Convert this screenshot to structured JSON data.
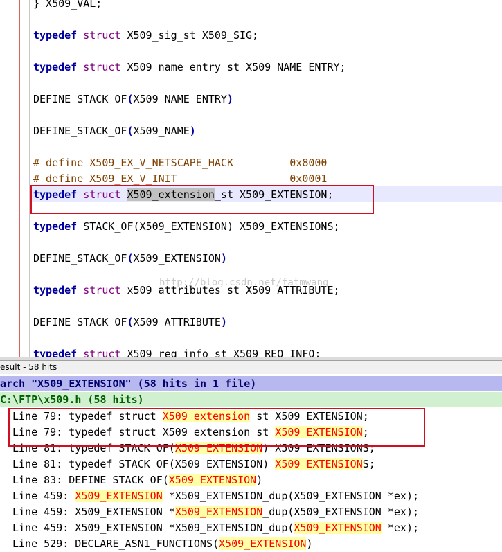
{
  "editor": {
    "lines": [
      {
        "segs": [
          {
            "t": "} X509_VAL;"
          }
        ]
      },
      {
        "segs": []
      },
      {
        "segs": [
          {
            "t": "typedef",
            "c": "kw"
          },
          {
            "t": " "
          },
          {
            "t": "struct",
            "c": "ty"
          },
          {
            "t": " X509_sig_st X509_SIG;"
          }
        ]
      },
      {
        "segs": []
      },
      {
        "segs": [
          {
            "t": "typedef",
            "c": "kw"
          },
          {
            "t": " "
          },
          {
            "t": "struct",
            "c": "ty"
          },
          {
            "t": " X509_name_entry_st X509_NAME_ENTRY;"
          }
        ]
      },
      {
        "segs": []
      },
      {
        "segs": [
          {
            "t": "DEFINE_STACK_OF"
          },
          {
            "t": "(",
            "c": "kw"
          },
          {
            "t": "X509_NAME_ENTRY"
          },
          {
            "t": ")",
            "c": "kw"
          }
        ]
      },
      {
        "segs": []
      },
      {
        "segs": [
          {
            "t": "DEFINE_STACK_OF"
          },
          {
            "t": "(",
            "c": "kw"
          },
          {
            "t": "X509_NAME"
          },
          {
            "t": ")",
            "c": "kw"
          }
        ]
      },
      {
        "segs": []
      },
      {
        "segs": [
          {
            "t": "# define X509_EX_V_NETSCAPE_HACK         0x8000",
            "c": "pp"
          }
        ]
      },
      {
        "segs": [
          {
            "t": "# define X509_EX_V_INIT                  0x0001",
            "c": "pp"
          }
        ]
      },
      {
        "segs": [
          {
            "t": "typedef",
            "c": "kw"
          },
          {
            "t": " "
          },
          {
            "t": "struct",
            "c": "ty"
          },
          {
            "t": " "
          },
          {
            "t": "X509_extension",
            "c": "sel"
          },
          {
            "t": "_st X509_EXTENSION;"
          }
        ]
      },
      {
        "segs": []
      },
      {
        "segs": [
          {
            "t": "typedef",
            "c": "kw"
          },
          {
            "t": " STACK_OF(X509_EXTENSION) X509_EXTENSIONS;"
          }
        ]
      },
      {
        "segs": []
      },
      {
        "segs": [
          {
            "t": "DEFINE_STACK_OF"
          },
          {
            "t": "(",
            "c": "kw"
          },
          {
            "t": "X509_EXTENSION"
          },
          {
            "t": ")",
            "c": "kw"
          }
        ]
      },
      {
        "segs": []
      },
      {
        "segs": [
          {
            "t": "typedef",
            "c": "kw"
          },
          {
            "t": " "
          },
          {
            "t": "struct",
            "c": "ty"
          },
          {
            "t": " x509_attributes_st X509_ATTRIBUTE;"
          }
        ]
      },
      {
        "segs": []
      },
      {
        "segs": [
          {
            "t": "DEFINE_STACK_OF"
          },
          {
            "t": "(",
            "c": "kw"
          },
          {
            "t": "X509_ATTRIBUTE"
          },
          {
            "t": ")",
            "c": "kw"
          }
        ]
      },
      {
        "segs": []
      },
      {
        "segs": [
          {
            "t": "typedef",
            "c": "kw"
          },
          {
            "t": " "
          },
          {
            "t": "struct",
            "c": "ty"
          },
          {
            "t": " X509_req_info_st X509_REQ_INFO;"
          }
        ]
      }
    ],
    "watermark": "http://blog.csdn.net/fatmwang"
  },
  "finder": {
    "title": "esult - 58 hits",
    "search_header": "arch \"X509_EXTENSION\" (58 hits in 1 file)",
    "file_header": "C:\\FTP\\x509.h (58 hits)",
    "results": [
      {
        "segs": [
          {
            "t": "Line 79: typedef struct "
          },
          {
            "t": "X509_extension",
            "m": 1
          },
          {
            "t": "_st X509_EXTENSION;"
          }
        ]
      },
      {
        "segs": [
          {
            "t": "Line 79: typedef struct X509_extension_st "
          },
          {
            "t": "X509_EXTENSION",
            "m": 1
          },
          {
            "t": ";"
          }
        ]
      },
      {
        "segs": [
          {
            "t": "Line 81: typedef STACK_OF("
          },
          {
            "t": "X509_EXTENSION",
            "m": 1
          },
          {
            "t": ") X509_EXTENSIONS;"
          }
        ]
      },
      {
        "segs": [
          {
            "t": "Line 81: typedef STACK_OF(X509_EXTENSION) "
          },
          {
            "t": "X509_EXTENSION",
            "m": 1
          },
          {
            "t": "S;"
          }
        ]
      },
      {
        "segs": [
          {
            "t": "Line 83: DEFINE_STACK_OF("
          },
          {
            "t": "X509_EXTENSION",
            "m": 1
          },
          {
            "t": ")"
          }
        ]
      },
      {
        "segs": [
          {
            "t": "Line 459: "
          },
          {
            "t": "X509_EXTENSION",
            "m": 1
          },
          {
            "t": " *X509_EXTENSION_dup(X509_EXTENSION *ex);"
          }
        ]
      },
      {
        "segs": [
          {
            "t": "Line 459: X509_EXTENSION *"
          },
          {
            "t": "X509_EXTENSION",
            "m": 1
          },
          {
            "t": "_dup(X509_EXTENSION *ex);"
          }
        ]
      },
      {
        "segs": [
          {
            "t": "Line 459: X509_EXTENSION *X509_EXTENSION_dup("
          },
          {
            "t": "X509_EXTENSION",
            "m": 1
          },
          {
            "t": " *ex);"
          }
        ]
      },
      {
        "segs": [
          {
            "t": "Line 529: DECLARE_ASN1_FUNCTIONS("
          },
          {
            "t": "X509_EXTENSION",
            "m": 1
          },
          {
            "t": ")"
          }
        ]
      }
    ]
  },
  "colors": {
    "highlight_box": "#d01020",
    "match_fg": "#ff0000",
    "match_bg": "#ffffa8"
  }
}
